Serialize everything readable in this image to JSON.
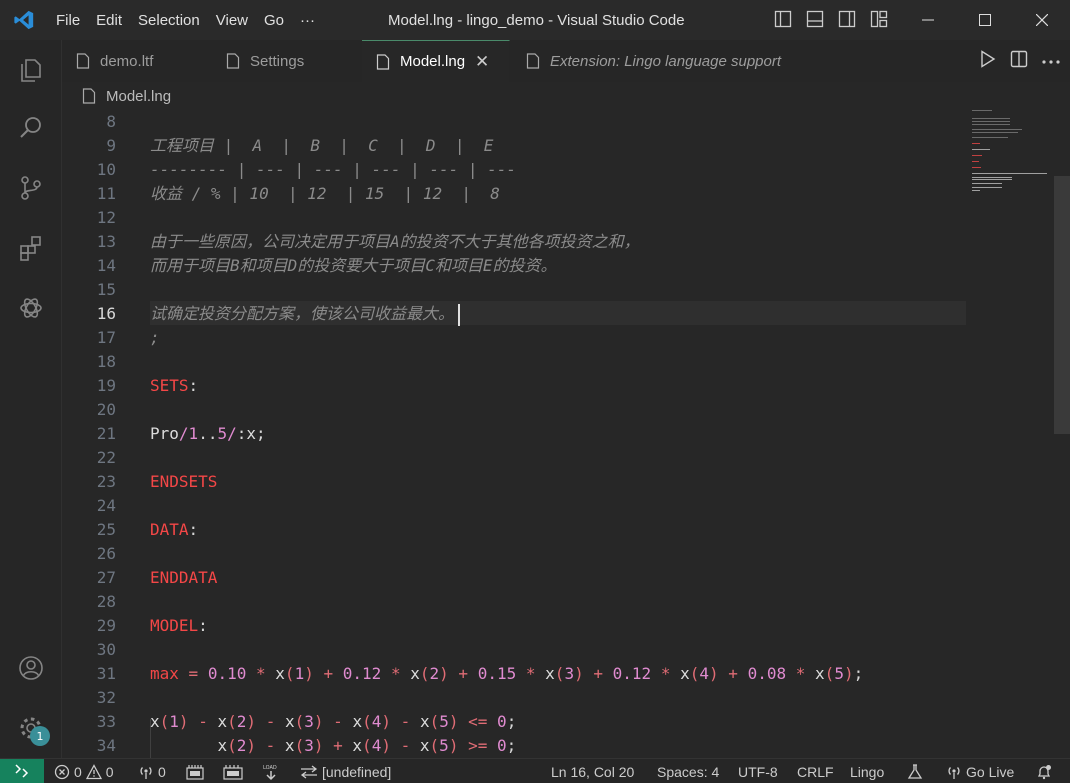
{
  "titlebar": {
    "menu": [
      "File",
      "Edit",
      "Selection",
      "View",
      "Go",
      "···"
    ],
    "title": "Model.lng - lingo_demo - Visual Studio Code"
  },
  "tabs": [
    {
      "label": "demo.ltf",
      "icon": "file-icon"
    },
    {
      "label": "Settings",
      "icon": "file-icon"
    },
    {
      "label": "Model.lng",
      "icon": "file-icon",
      "active": true,
      "close": "✕"
    },
    {
      "label": "Extension: Lingo language support",
      "icon": "file-icon",
      "italic": true
    }
  ],
  "breadcrumb": {
    "file": "Model.lng"
  },
  "editor": {
    "current_line": 16,
    "lines": [
      {
        "n": "8",
        "text": ""
      },
      {
        "n": "9",
        "text": "工程项目 |  A  |  B  |  C  |  D  |  E"
      },
      {
        "n": "10",
        "text": "-------- | --- | --- | --- | --- | ---"
      },
      {
        "n": "11",
        "text": "收益 / % | 10  | 12  | 15  | 12  |  8"
      },
      {
        "n": "12",
        "text": ""
      },
      {
        "n": "13",
        "text": "由于一些原因，公司决定用于项目A的投资不大于其他各项投资之和，"
      },
      {
        "n": "14",
        "text": "而用于项目B和项目D的投资要大于项目C和项目E的投资。"
      },
      {
        "n": "15",
        "text": ""
      },
      {
        "n": "16",
        "text": "试确定投资分配方案，使该公司收益最大。"
      },
      {
        "n": "17",
        "text": ";"
      },
      {
        "n": "18",
        "text": ""
      },
      {
        "n": "19",
        "text": "SETS:"
      },
      {
        "n": "20",
        "text": ""
      },
      {
        "n": "21",
        "text": "Pro/1..5/:x;"
      },
      {
        "n": "22",
        "text": ""
      },
      {
        "n": "23",
        "text": "ENDSETS"
      },
      {
        "n": "24",
        "text": ""
      },
      {
        "n": "25",
        "text": "DATA:"
      },
      {
        "n": "26",
        "text": ""
      },
      {
        "n": "27",
        "text": "ENDDATA"
      },
      {
        "n": "28",
        "text": ""
      },
      {
        "n": "29",
        "text": "MODEL:"
      },
      {
        "n": "30",
        "text": ""
      },
      {
        "n": "31",
        "text": "max = 0.10 * x(1) + 0.12 * x(2) + 0.15 * x(3) + 0.12 * x(4) + 0.08 * x(5);"
      },
      {
        "n": "32",
        "text": ""
      },
      {
        "n": "33",
        "text": "x(1) - x(2) - x(3) - x(4) - x(5) <= 0;"
      },
      {
        "n": "34",
        "text": "       x(2) - x(3) + x(4) - x(5) >= 0;"
      }
    ]
  },
  "statusbar": {
    "errors": "0",
    "warnings": "0",
    "ports": "0",
    "sync": "[undefined]",
    "position": "Ln 16, Col 20",
    "spaces": "Spaces: 4",
    "encoding": "UTF-8",
    "eol": "CRLF",
    "language": "Lingo",
    "golive": "Go Live"
  },
  "colors": {
    "accent": "#16825d",
    "badge": "#3a8f98",
    "keyword": "#f44747",
    "comment": "#8b8b8b"
  }
}
